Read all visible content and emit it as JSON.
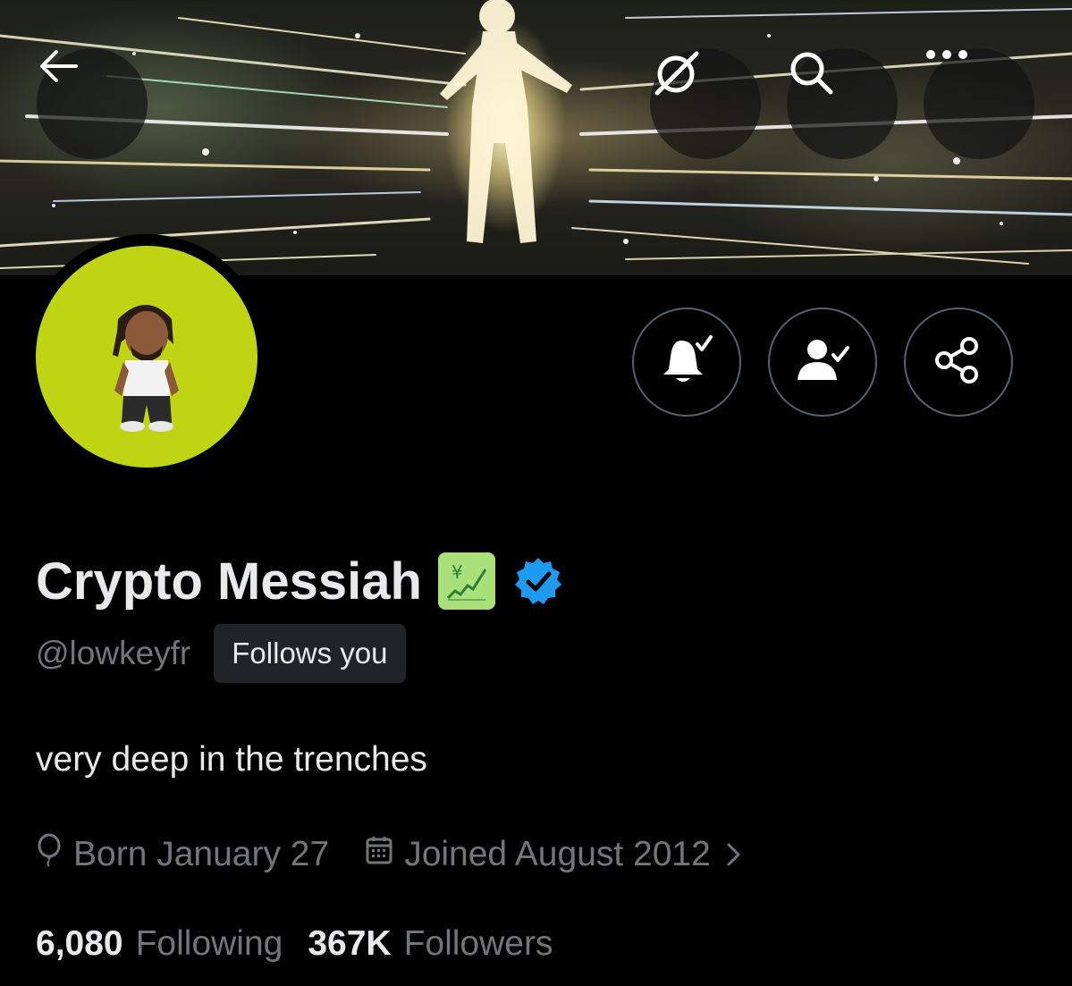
{
  "profile": {
    "display_name": "Crypto Messiah",
    "name_emoji": "💹",
    "handle": "@lowkeyfr",
    "follows_you_badge": "Follows you",
    "bio": "very deep in the trenches",
    "born": "Born January 27",
    "joined": "Joined August 2012",
    "following_count": "6,080",
    "following_label": "Following",
    "followers_count": "367K",
    "followers_label": "Followers"
  },
  "header_buttons": {
    "icons": [
      "back-arrow-icon",
      "grok-icon",
      "search-icon",
      "more-icon"
    ]
  },
  "action_buttons": {
    "icons": [
      "notifications-on-icon",
      "following-check-icon",
      "share-icon"
    ]
  },
  "colors": {
    "background": "#000000",
    "primary_text": "#e7e9ea",
    "secondary_text": "#71767b",
    "verified_blue": "#1d9bf0",
    "avatar_bg": "#bfd413",
    "button_border": "#536471",
    "badge_bg": "#202327"
  }
}
